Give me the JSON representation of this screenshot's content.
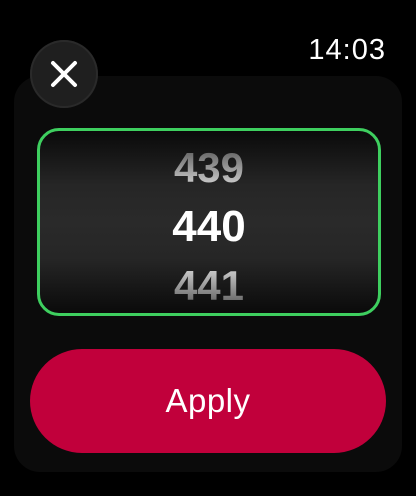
{
  "status_bar": {
    "time": "14:03"
  },
  "close": {
    "icon": "close-icon"
  },
  "picker": {
    "previous_value": "439",
    "current_value": "440",
    "next_value": "441",
    "border_color": "#3ecf5f"
  },
  "apply": {
    "label": "Apply",
    "color": "#c1003b"
  }
}
